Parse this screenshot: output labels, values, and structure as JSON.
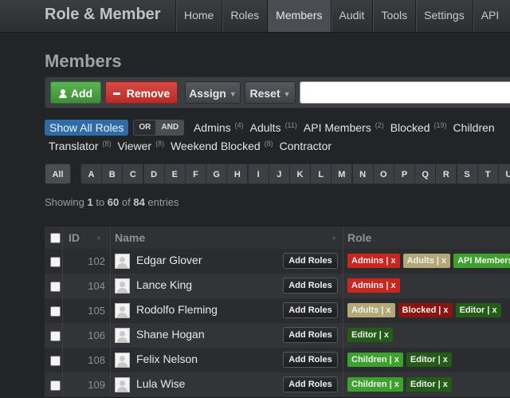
{
  "brand": "Role & Member",
  "nav": [
    "Home",
    "Roles",
    "Members",
    "Audit",
    "Tools",
    "Settings",
    "API"
  ],
  "nav_active": "Members",
  "page_title": "Members",
  "toolbar": {
    "add": "Add",
    "remove": "Remove",
    "assign": "Assign",
    "reset": "Reset",
    "search_value": ""
  },
  "filters": {
    "show_all": "Show All Roles",
    "or": "OR",
    "and": "AND",
    "line1": [
      {
        "name": "Admins",
        "count": "(4)"
      },
      {
        "name": "Adults",
        "count": "(11)"
      },
      {
        "name": "API Members",
        "count": "(2)"
      },
      {
        "name": "Blocked",
        "count": "(19)"
      },
      {
        "name": "Children",
        "count": ""
      }
    ],
    "line2": [
      {
        "name": "Translator",
        "count": "(8)"
      },
      {
        "name": "Viewer",
        "count": "(8)"
      },
      {
        "name": "Weekend Blocked",
        "count": "(8)"
      },
      {
        "name": "Contractor",
        "count": ""
      }
    ]
  },
  "alphabet": {
    "all": "All",
    "letters": [
      "A",
      "B",
      "C",
      "D",
      "E",
      "F",
      "G",
      "H",
      "I",
      "J",
      "K",
      "L",
      "M",
      "N",
      "O",
      "P",
      "Q",
      "R",
      "S",
      "T",
      "U"
    ]
  },
  "showing": {
    "prefix": "Showing ",
    "from": "1",
    "to_word": " to ",
    "to": "60",
    "of_word": " of ",
    "total": "84",
    "suffix": " entries"
  },
  "table": {
    "headers": {
      "id": "ID",
      "name": "Name",
      "role": "Role"
    },
    "add_roles_label": "Add Roles",
    "rows": [
      {
        "id": "102",
        "name": "Edgar Glover",
        "roles": [
          "Admins",
          "Adults",
          "API Members"
        ]
      },
      {
        "id": "104",
        "name": "Lance King",
        "roles": [
          "Admins"
        ]
      },
      {
        "id": "105",
        "name": "Rodolfo Fleming",
        "roles": [
          "Adults",
          "Blocked",
          "Editor"
        ]
      },
      {
        "id": "106",
        "name": "Shane Hogan",
        "roles": [
          "Editor"
        ]
      },
      {
        "id": "108",
        "name": "Felix Nelson",
        "roles": [
          "Children",
          "Editor"
        ]
      },
      {
        "id": "109",
        "name": "Lula Wise",
        "roles": [
          "Children",
          "Editor"
        ]
      }
    ]
  },
  "role_colors": {
    "Admins": "#c8261f",
    "Adults": "#b5a877",
    "API Members": "#3ea12d",
    "Blocked": "#8a1410",
    "Editor": "#245c17",
    "Children": "#3ea12d"
  },
  "role_remove_glyph": "| x"
}
